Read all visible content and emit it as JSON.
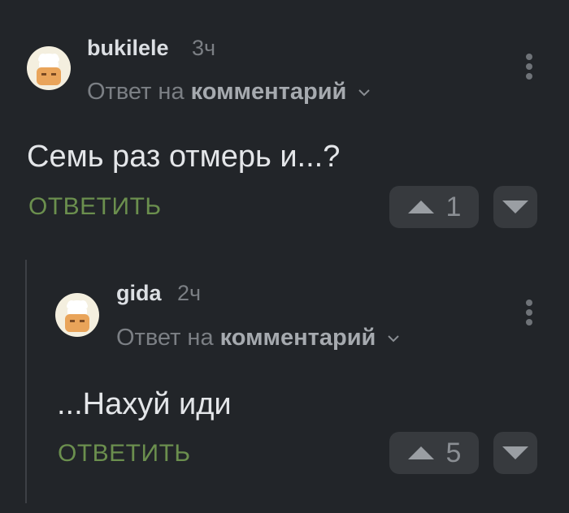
{
  "comments": [
    {
      "author": "bukilele",
      "time": "3ч",
      "reply_prefix": "Ответ на",
      "reply_target": "комментарий",
      "text": "Семь раз отмерь и...?",
      "reply_label": "ОТВЕТИТЬ",
      "votes": "1",
      "avatar_icon": "chef-hat-avatar"
    },
    {
      "author": "gida",
      "time": "2ч",
      "reply_prefix": "Ответ на",
      "reply_target": "комментарий",
      "text": "...Нахуй иди",
      "reply_label": "ОТВЕТИТЬ",
      "votes": "5",
      "avatar_icon": "chef-hat-avatar"
    }
  ],
  "colors": {
    "background": "#222529",
    "reply_button": "#6b8f4e",
    "vote_button_bg": "#373a3e"
  }
}
